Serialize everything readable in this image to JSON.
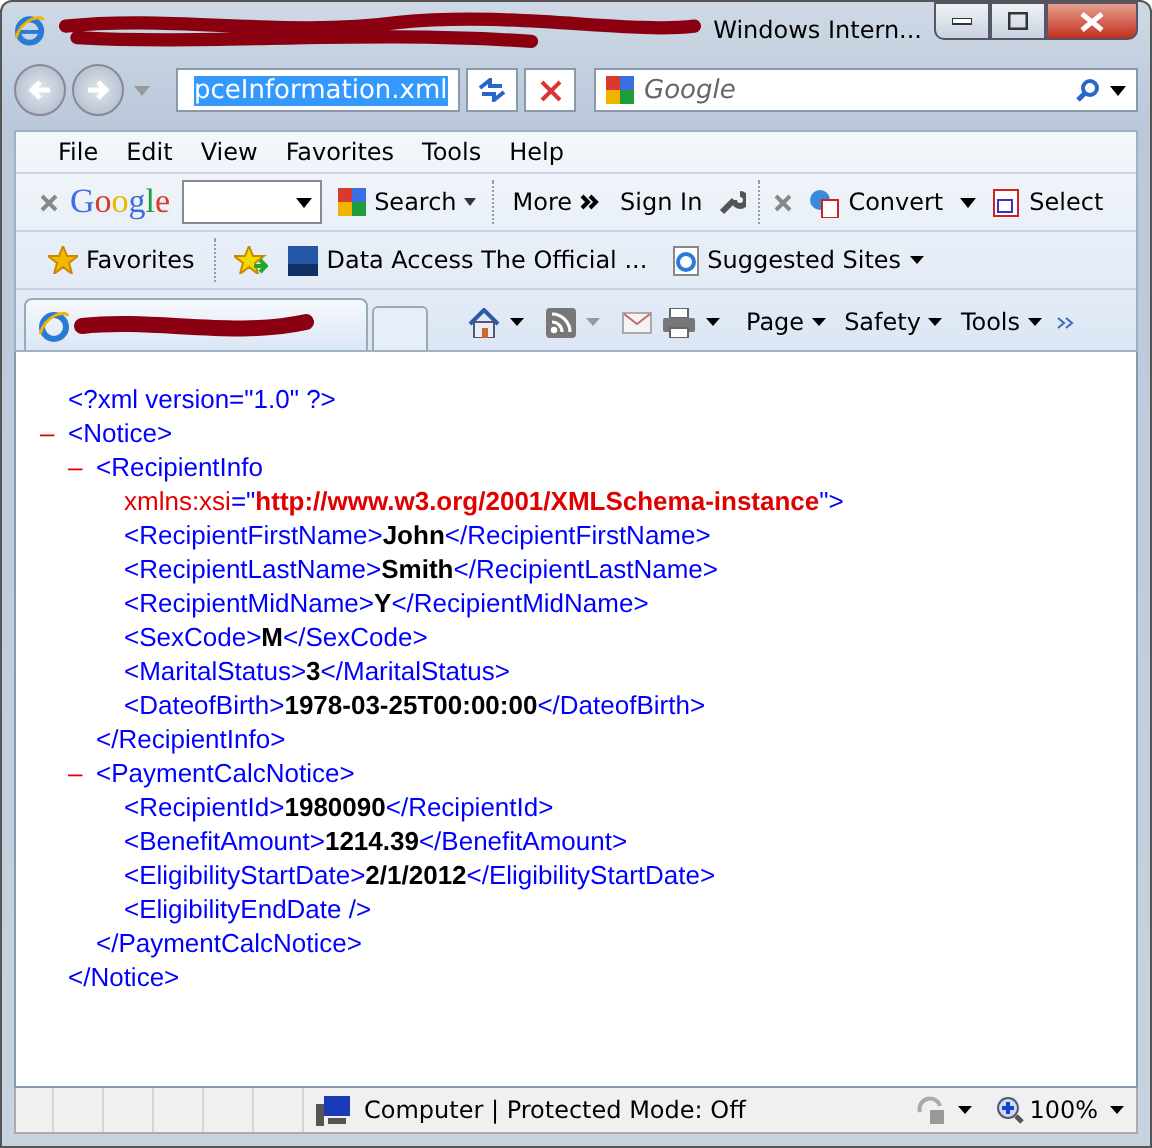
{
  "window": {
    "title": "Windows Intern...",
    "title_redacted": true
  },
  "address_bar": {
    "value": "pceInformation.xml",
    "text_selected": true
  },
  "search": {
    "placeholder": "Google"
  },
  "menu": [
    {
      "label": "File"
    },
    {
      "label": "Edit"
    },
    {
      "label": "View"
    },
    {
      "label": "Favorites"
    },
    {
      "label": "Tools"
    },
    {
      "label": "Help"
    }
  ],
  "google_toolbar": {
    "logo": "Google",
    "search_button": "Search",
    "more": "More",
    "sign_in": "Sign In"
  },
  "pdf_toolbar": {
    "convert": "Convert",
    "select": "Select"
  },
  "favorites_bar": {
    "favorites": "Favorites",
    "links": [
      {
        "label": "Data Access The Official ...",
        "kind": "aspnet"
      },
      {
        "label": "Suggested Sites",
        "kind": "ie"
      }
    ]
  },
  "tab": {
    "title_redacted": true
  },
  "command_bar": [
    "Page",
    "Safety",
    "Tools"
  ],
  "document": {
    "declaration": "<?xml version=\"1.0\" ?>",
    "root": {
      "toggle": "–",
      "open": "<Notice>",
      "close": "</Notice>",
      "children": [
        {
          "toggle": "–",
          "open": "<RecipientInfo",
          "attribute": {
            "name": "xmlns:xsi",
            "equals": "=\"",
            "value": "http://www.w3.org/2001/XMLSchema-instance",
            "end": "\">"
          },
          "close": "</RecipientInfo>",
          "children": [
            {
              "open": "<RecipientFirstName>",
              "value": "John",
              "close": "</RecipientFirstName>"
            },
            {
              "open": "<RecipientLastName>",
              "value": "Smith",
              "close": "</RecipientLastName>"
            },
            {
              "open": "<RecipientMidName>",
              "value": "Y",
              "close": "</RecipientMidName>"
            },
            {
              "open": "<SexCode>",
              "value": "M",
              "close": "</SexCode>"
            },
            {
              "open": "<MaritalStatus>",
              "value": "3",
              "close": "</MaritalStatus>"
            },
            {
              "open": "<DateofBirth>",
              "value": "1978-03-25T00:00:00",
              "close": "</DateofBirth>"
            }
          ]
        },
        {
          "toggle": "–",
          "open": "<PaymentCalcNotice>",
          "close": "</PaymentCalcNotice>",
          "children": [
            {
              "open": "<RecipientId>",
              "value": "1980090",
              "close": "</RecipientId>"
            },
            {
              "open": "<BenefitAmount>",
              "value": "1214.39",
              "close": "</BenefitAmount>"
            },
            {
              "open": "<EligibilityStartDate>",
              "value": "2/1/2012",
              "close": "</EligibilityStartDate>"
            },
            {
              "open": "<EligibilityEndDate />"
            }
          ]
        }
      ]
    }
  },
  "status_bar": {
    "zone": "Computer | Protected Mode: Off",
    "zoom": "100%"
  }
}
